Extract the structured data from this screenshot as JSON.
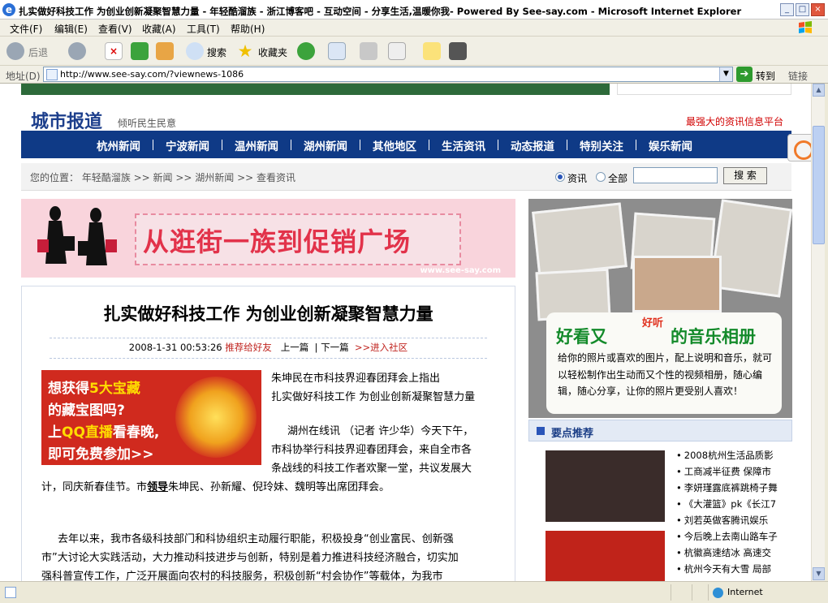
{
  "window": {
    "title": "扎实做好科技工作 为创业创新凝聚智慧力量 - 年轻酷溜族 - 浙江博客吧 - 互动空间 - 分享生活,温暖你我- Powered By See-say.com - Microsoft Internet Explorer"
  },
  "menu": [
    "文件(F)",
    "编辑(E)",
    "查看(V)",
    "收藏(A)",
    "工具(T)",
    "帮助(H)"
  ],
  "toolbar": {
    "back": "后退",
    "search": "搜索",
    "favorites": "收藏夹"
  },
  "address": {
    "label": "地址(D)",
    "url": "http://www.see-say.com/?viewnews-1086",
    "go": "转到",
    "links": "链接"
  },
  "site": {
    "brand": "城市报道",
    "brand_sub": "倾听民生民意",
    "slogan": "最强大的资讯信息平台",
    "nav": [
      "杭州新闻",
      "宁波新闻",
      "温州新闻",
      "湖州新闻",
      "其他地区",
      "生活资讯",
      "动态报道",
      "特别关注",
      "娱乐新闻"
    ],
    "breadcrumb": "您的位置： 年轻酷溜族 >> 新闻 >> 湖州新闻 >> 查看资讯",
    "search": {
      "opt_news": "资讯",
      "opt_all": "全部",
      "button": "搜 索"
    }
  },
  "banner": {
    "text": "从逛街一族到促销广场",
    "site": "www.see-say.com"
  },
  "article": {
    "title": "扎实做好科技工作 为创业创新凝聚智慧力量",
    "date": "2008-1-31 00:53:26",
    "recommend": "推荐给好友",
    "prev": "上一篇",
    "next": "下一篇",
    "community": ">>进入社区",
    "summary1": "朱坤民在市科技界迎春团拜会上指出",
    "summary2": "扎实做好科技工作 为创业创新凝聚智慧力量",
    "p1_l1": "湖州在线讯 （记者 许少华）今天下午，",
    "p1_l2": "市科协举行科技界迎春团拜会，来自全市各",
    "p1_l3": "条战线的科技工作者欢聚一堂，共议发展大",
    "p1_l4a": "计，同庆新春佳节。市",
    "p1_l4b": "领导",
    "p1_l4c": "朱坤民、孙新耀、倪玲妹、魏明等出席团拜会。",
    "p2_l1": "去年以来，我市各级科技部门和科协组织主动履行职能，积极投身“创业富民、创新强",
    "p2_l2": "市”大讨论大实践活动，大力推动科技进步与创新，特别是着力推进科技经济融合，切实加",
    "p2_l3": "强科普宣传工作，广泛开展面向农村的科技服务，积极创新“村会协作”等载体，为我市"
  },
  "promo": {
    "l1a": "想获得",
    "l1b": "5大宝藏",
    "l2": "的藏宝图吗?",
    "l3a": "上",
    "l3b": "QQ直播",
    "l3c": "看春晚,",
    "l4": "即可免费参加>>"
  },
  "side_ad": {
    "headline_a": "好看又",
    "headline_hl": "好听",
    "headline_b": "的音乐相册",
    "desc": "给你的照片或喜欢的图片，配上说明和音乐，就可以轻松制作出生动而又个性的视频相册，随心编辑，随心分享，让你的照片更受别人喜欢！"
  },
  "recommend": {
    "title": "要点推荐",
    "items": [
      "2008杭州生活品质影",
      "工商减半征费 保障市",
      "李妍瑾露底裤跳椅子舞",
      "《大灌篮》pk《长江7",
      "刘若英做客腾讯娱乐",
      "今后晚上去南山路车子",
      "杭徽高速结冰 高速交",
      "杭州今天有大雪 局部"
    ]
  },
  "status": {
    "zone": "Internet"
  }
}
